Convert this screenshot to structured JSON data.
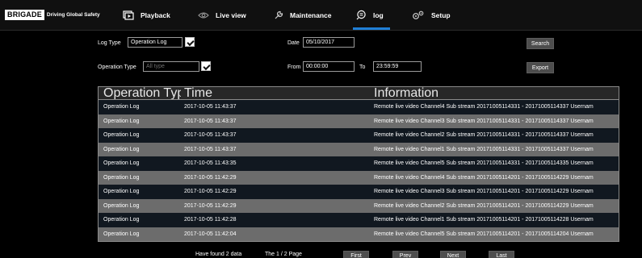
{
  "brand": {
    "logo": "BRIGADE",
    "tagline": "Driving Global Safety"
  },
  "nav": {
    "playback": "Playback",
    "live_view": "Live view",
    "maintenance": "Maintenance",
    "log": "log",
    "setup": "Setup",
    "active": "log",
    "accent_color": "#1f7fd6"
  },
  "filters": {
    "log_type_label": "Log Type",
    "log_type_value": "Operation Log",
    "operation_type_label": "Operation Type",
    "operation_type_value": "All type",
    "date_label": "Date",
    "date_value": "05/10/2017",
    "from_label": "From",
    "from_value": "00:00:00",
    "to_label": "To",
    "to_value": "23:59:59",
    "search_button": "Search",
    "export_button": "Export"
  },
  "table": {
    "columns": [
      "Operation Type",
      "Time",
      "Information"
    ],
    "rows": [
      [
        "Operation Log",
        "2017-10-05 11:43:37",
        "Remote live video Channel4 Sub stream 20171005114331 - 20171005114337 Usernam"
      ],
      [
        "Operation Log",
        "2017-10-05 11:43:37",
        "Remote live video Channel3 Sub stream 20171005114331 - 20171005114337 Usernam"
      ],
      [
        "Operation Log",
        "2017-10-05 11:43:37",
        "Remote live video Channel2 Sub stream 20171005114331 - 20171005114337 Usernam"
      ],
      [
        "Operation Log",
        "2017-10-05 11:43:37",
        "Remote live video Channel1 Sub stream 20171005114331 - 20171005114337 Usernam"
      ],
      [
        "Operation Log",
        "2017-10-05 11:43:35",
        "Remote live video Channel5 Sub stream 20171005114331 - 20171005114335 Usernam"
      ],
      [
        "Operation Log",
        "2017-10-05 11:42:29",
        "Remote live video Channel4 Sub stream 20171005114201 - 20171005114229 Usernam"
      ],
      [
        "Operation Log",
        "2017-10-05 11:42:29",
        "Remote live video Channel3 Sub stream 20171005114201 - 20171005114229 Usernam"
      ],
      [
        "Operation Log",
        "2017-10-05 11:42:29",
        "Remote live video Channel2 Sub stream 20171005114201 - 20171005114229 Usernam"
      ],
      [
        "Operation Log",
        "2017-10-05 11:42:28",
        "Remote live video Channel1 Sub stream 20171005114201 - 20171005114228 Usernam"
      ],
      [
        "Operation Log",
        "2017-10-05 11:42:04",
        "Remote live video Channel5 Sub stream 20171005114201 - 20171005114204 Usernam"
      ]
    ]
  },
  "pager": {
    "found_text": "Have found 2 data",
    "page_text": "The 1 / 2 Page",
    "first": "First",
    "prev": "Prev",
    "next": "Next",
    "last": "Last"
  }
}
